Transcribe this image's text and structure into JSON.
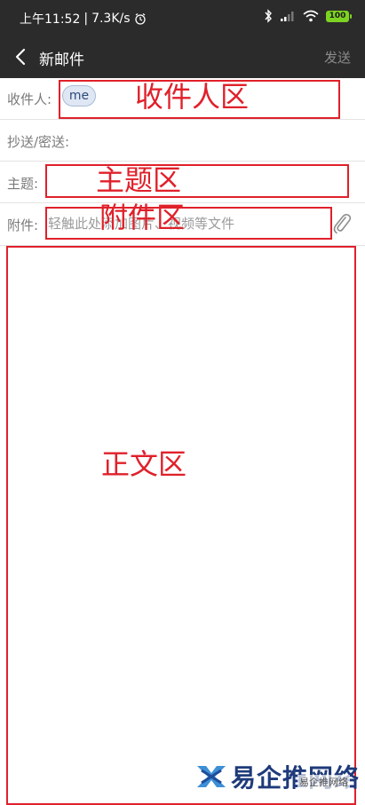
{
  "status_bar": {
    "time": "上午11:52",
    "separator": "|",
    "speed": "7.3K/s",
    "icons": [
      "alarm-icon",
      "bluetooth-icon",
      "signal-icon",
      "wifi-icon"
    ],
    "battery": "100",
    "battery_color": "#7dd321"
  },
  "nav": {
    "title": "新邮件",
    "send_label": "发送",
    "back_icon": "chevron-left-icon"
  },
  "form": {
    "to_label": "收件人:",
    "to_chip": "me",
    "cc_label": "抄送/密送:",
    "subject_label": "主题:",
    "attach_label": "附件:",
    "attach_placeholder": "轻触此处添加图片、视频等文件",
    "attach_icon": "paperclip-icon"
  },
  "annotations": {
    "recipient": "收件人区",
    "subject": "主题区",
    "attachment": "附件区",
    "body": "正文区",
    "color": "#e0202a"
  },
  "watermark": {
    "brand": "易企推网络",
    "tag": "易企推网络"
  },
  "colors": {
    "bar": "#2b2b2b",
    "label": "#7a7a7a",
    "chip_bg": "#dfe7f4"
  }
}
